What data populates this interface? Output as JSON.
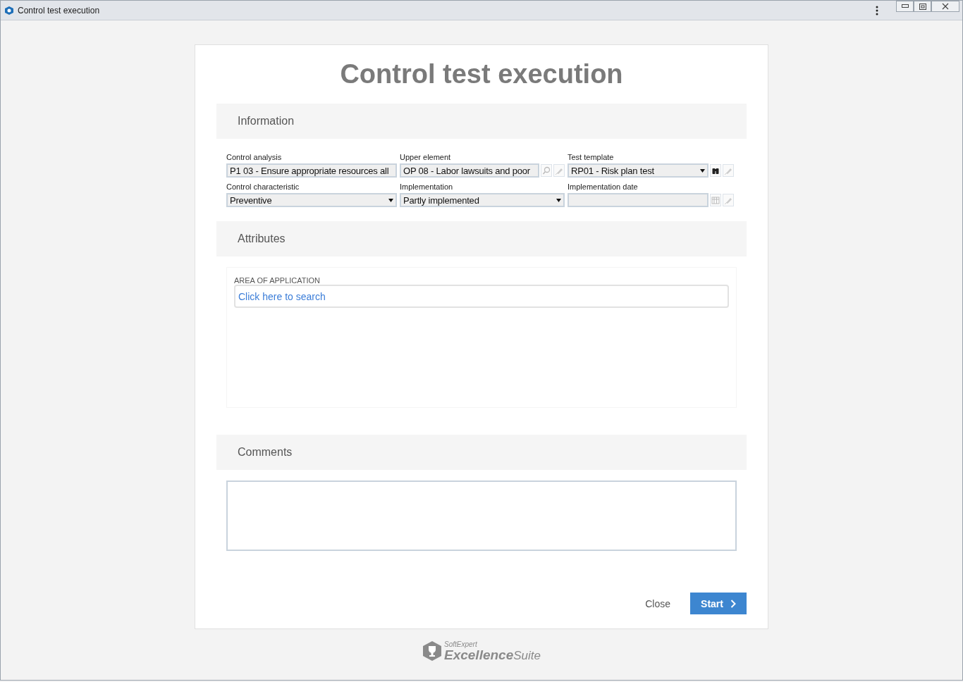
{
  "window": {
    "title": "Control test execution"
  },
  "page_title": "Control test execution",
  "information": {
    "heading": "Information",
    "fields": [
      {
        "label": "Control analysis",
        "value": "P1 03 - Ensure appropriate resources all",
        "kind": "text"
      },
      {
        "label": "Upper element",
        "value": "OP 08 - Labor lawsuits and poor",
        "kind": "lookup"
      },
      {
        "label": "Test template",
        "value": "RP01 - Risk plan test",
        "kind": "select-lookup"
      },
      {
        "label": "Control characteristic",
        "value": "Preventive",
        "kind": "select"
      },
      {
        "label": "Implementation",
        "value": "Partly implemented",
        "kind": "select"
      },
      {
        "label": "Implementation date",
        "kind": "date"
      }
    ]
  },
  "attributes": {
    "heading": "Attributes",
    "area_label": "AREA OF APPLICATION",
    "area_link": "Click here to search"
  },
  "comments": {
    "heading": "Comments"
  },
  "buttons": {
    "close": "Close",
    "start": "Start"
  },
  "footer_logo": {
    "small": "SoftExpert",
    "main": "Excellence",
    "suffix": "Suite"
  }
}
